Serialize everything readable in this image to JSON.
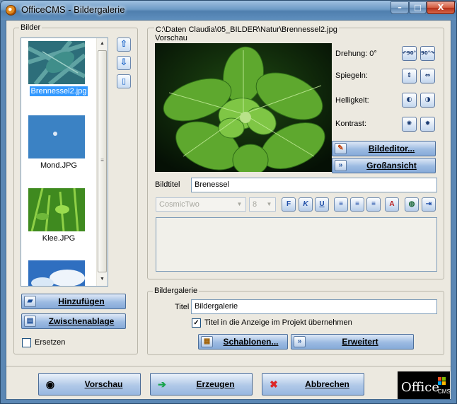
{
  "window": {
    "title": "OfficeCMS - Bildergalerie",
    "minimize_glyph": "–",
    "maximize_glyph": "□",
    "close_glyph": "X"
  },
  "images_group": {
    "label": "Bilder",
    "items": [
      {
        "name": "Brennessel2.jpg",
        "selected": true,
        "thumb": "nettle-thumbnail"
      },
      {
        "name": "Mond.JPG",
        "selected": false,
        "thumb": "moon-thumbnail"
      },
      {
        "name": "Klee.JPG",
        "selected": false,
        "thumb": "clover-thumbnail"
      },
      {
        "name": "",
        "selected": false,
        "thumb": "sky-thumbnail"
      }
    ],
    "add_button": "Hinzufügen",
    "clipboard_button": "Zwischenablage",
    "replace_label": "Ersetzen",
    "replace_checked": false
  },
  "preview_group": {
    "path": "C:\\Daten Claudia\\05_BILDER\\Natur\\Brennessel2.jpg",
    "preview_label": "Vorschau",
    "rotation_label": "Drehung: 0°",
    "mirror_label": "Spiegeln:",
    "brightness_label": "Helligkeit:",
    "contrast_label": "Kontrast:",
    "rotate_left_glyph": "↶90°",
    "rotate_right_glyph": "90°↷",
    "image_editor_button": "Bildeditor...",
    "large_view_button": "Großansicht",
    "image_title_label": "Bildtitel",
    "image_title_value": "Brenessel",
    "font_name": "CosmicTwo",
    "font_size": "8",
    "format_buttons": [
      "F",
      "K",
      "U"
    ]
  },
  "gallery_group": {
    "label": "Bildergalerie",
    "title_label": "Titel",
    "title_value": "Bildergalerie",
    "apply_title_label": "Titel in die Anzeige im Projekt übernehmen",
    "apply_title_checked": true,
    "templates_button": "Schablonen...",
    "extended_button": "Erweitert"
  },
  "footer": {
    "preview_button": "Vorschau",
    "generate_button": "Erzeugen",
    "cancel_button": "Abbrechen",
    "logo_text": "Office",
    "logo_sub": "CMS"
  },
  "colors": {
    "accent": "#3399ff",
    "button_top": "#dfe9f7",
    "button_bottom": "#86aad8",
    "dialog_bg": "#ece9e0"
  }
}
